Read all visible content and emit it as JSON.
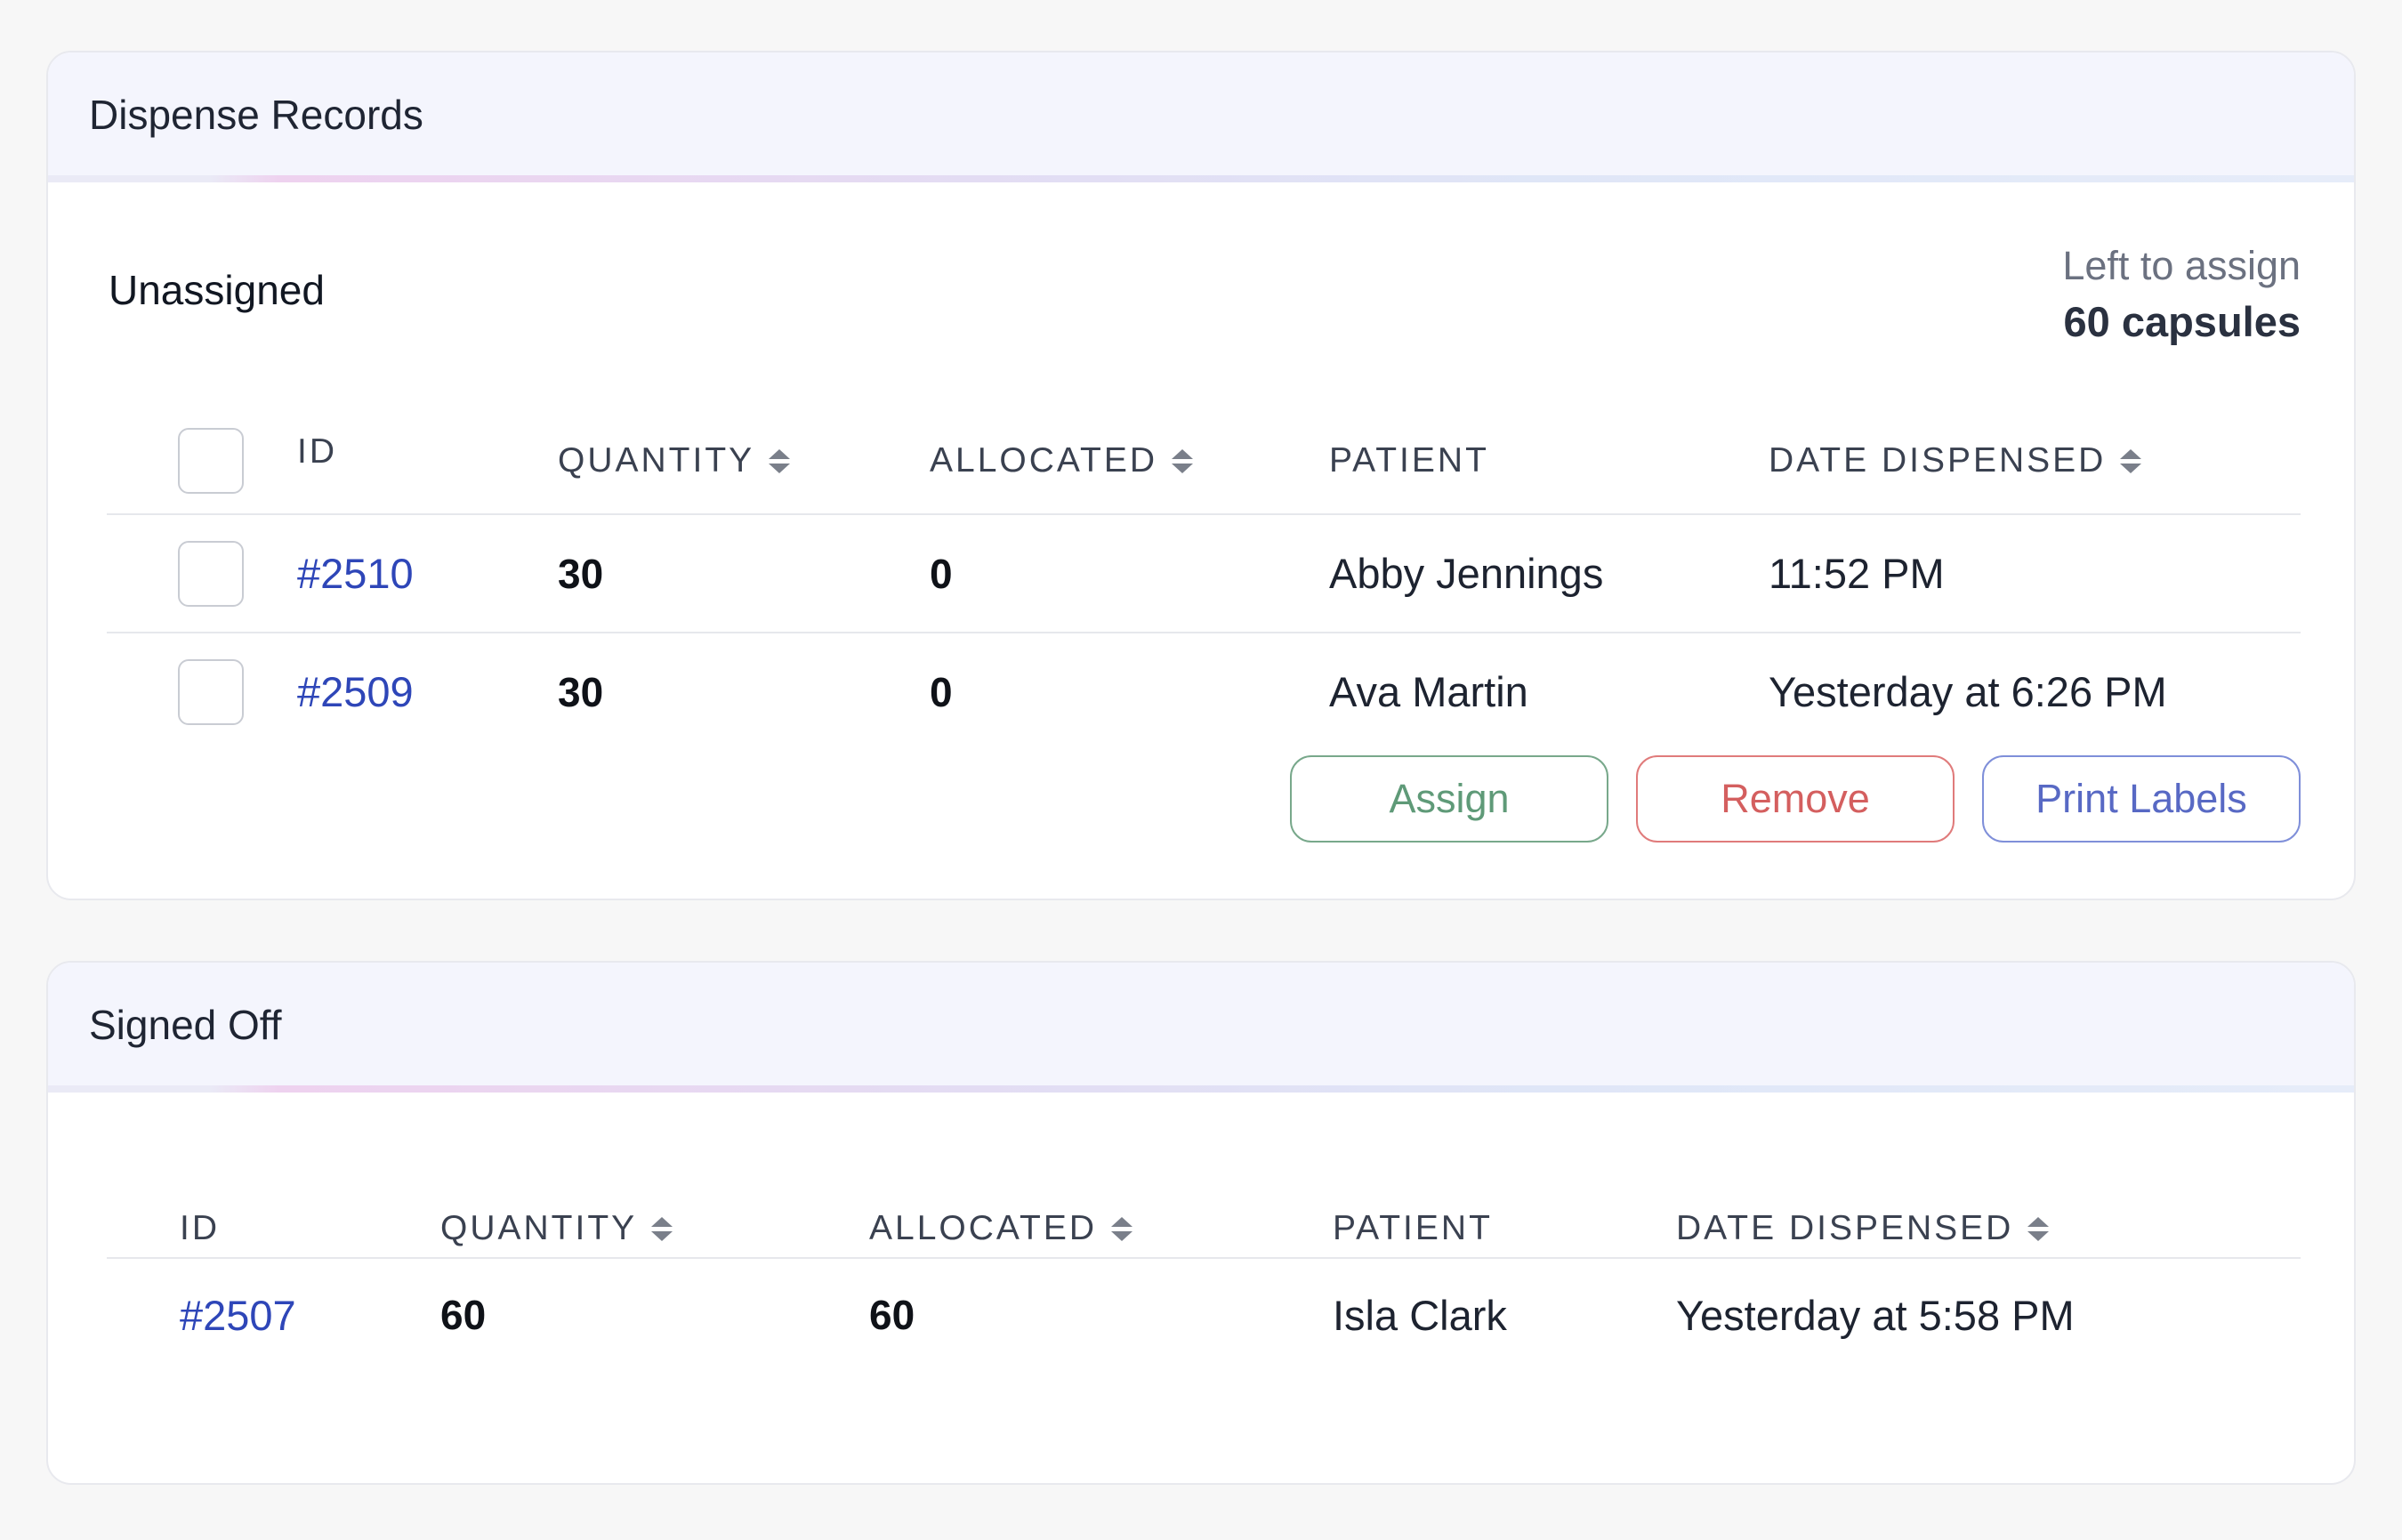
{
  "dispense": {
    "title": "Dispense Records",
    "section_label": "Unassigned",
    "left_to_assign_label": "Left to assign",
    "left_to_assign_value": "60 capsules",
    "columns": {
      "id": "ID",
      "quantity": "QUANTITY",
      "allocated": "ALLOCATED",
      "patient": "PATIENT",
      "date": "DATE DISPENSED"
    },
    "rows": [
      {
        "id": "#2510",
        "quantity": "30",
        "allocated": "0",
        "patient": "Abby Jennings",
        "date": "11:52 PM"
      },
      {
        "id": "#2509",
        "quantity": "30",
        "allocated": "0",
        "patient": "Ava Martin",
        "date": "Yesterday at 6:26 PM"
      }
    ],
    "buttons": {
      "assign": "Assign",
      "remove": "Remove",
      "print": "Print Labels"
    }
  },
  "signed_off": {
    "title": "Signed Off",
    "columns": {
      "id": "ID",
      "quantity": "QUANTITY",
      "allocated": "ALLOCATED",
      "patient": "PATIENT",
      "date": "DATE DISPENSED"
    },
    "rows": [
      {
        "id": "#2507",
        "quantity": "60",
        "allocated": "60",
        "patient": "Isla Clark",
        "date": "Yesterday at 5:58 PM"
      }
    ]
  },
  "icons": {
    "sort": "sort-arrows-icon",
    "checkbox": "checkbox"
  },
  "colors": {
    "link": "#2e46b8",
    "assign": "#5f9a78",
    "remove": "#d45f5f",
    "print": "#5869c4",
    "header_bg": "#f4f5fd"
  }
}
